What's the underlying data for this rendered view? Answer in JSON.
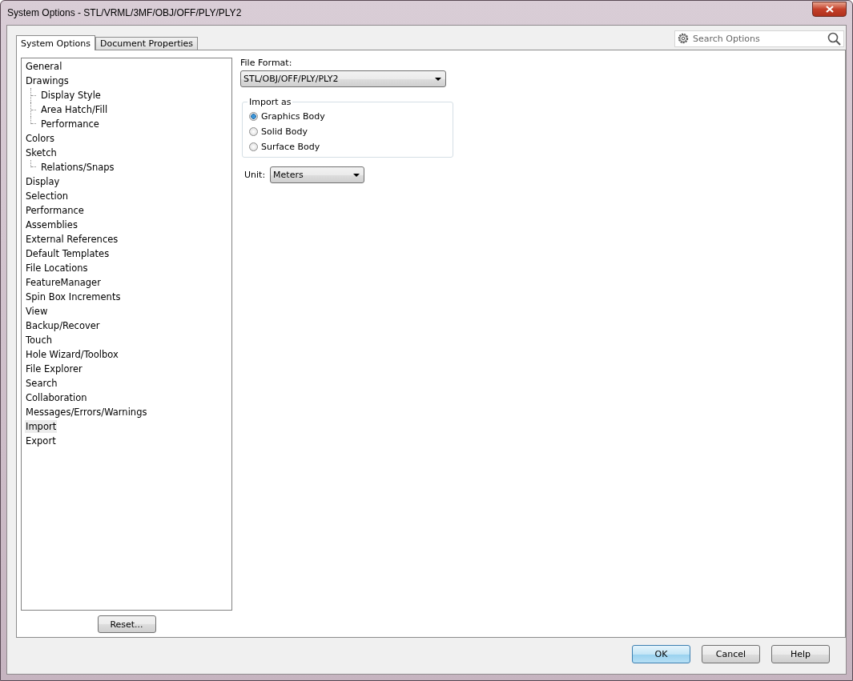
{
  "window": {
    "title": "System Options - STL/VRML/3MF/OBJ/OFF/PLY/PLY2"
  },
  "tabs": [
    {
      "label": "System Options",
      "selected": true
    },
    {
      "label": "Document Properties",
      "selected": false
    }
  ],
  "search": {
    "placeholder": "Search Options"
  },
  "tree": [
    {
      "label": "General",
      "selected": false
    },
    {
      "label": "Drawings",
      "selected": false,
      "children": [
        {
          "label": "Display Style",
          "selected": false
        },
        {
          "label": "Area Hatch/Fill",
          "selected": false
        },
        {
          "label": "Performance",
          "selected": false
        }
      ]
    },
    {
      "label": "Colors",
      "selected": false
    },
    {
      "label": "Sketch",
      "selected": false,
      "children": [
        {
          "label": "Relations/Snaps",
          "selected": false
        }
      ]
    },
    {
      "label": "Display",
      "selected": false
    },
    {
      "label": "Selection",
      "selected": false
    },
    {
      "label": "Performance",
      "selected": false
    },
    {
      "label": "Assemblies",
      "selected": false
    },
    {
      "label": "External References",
      "selected": false
    },
    {
      "label": "Default Templates",
      "selected": false
    },
    {
      "label": "File Locations",
      "selected": false
    },
    {
      "label": "FeatureManager",
      "selected": false
    },
    {
      "label": "Spin Box Increments",
      "selected": false
    },
    {
      "label": "View",
      "selected": false
    },
    {
      "label": "Backup/Recover",
      "selected": false
    },
    {
      "label": "Touch",
      "selected": false
    },
    {
      "label": "Hole Wizard/Toolbox",
      "selected": false
    },
    {
      "label": "File Explorer",
      "selected": false
    },
    {
      "label": "Search",
      "selected": false
    },
    {
      "label": "Collaboration",
      "selected": false
    },
    {
      "label": "Messages/Errors/Warnings",
      "selected": false
    },
    {
      "label": "Import",
      "selected": true
    },
    {
      "label": "Export",
      "selected": false
    }
  ],
  "reset_button": "Reset...",
  "file_format": {
    "label": "File Format:",
    "value": "STL/OBJ/OFF/PLY/PLY2"
  },
  "import_as": {
    "title": "Import as",
    "options": [
      {
        "label": "Graphics Body",
        "selected": true
      },
      {
        "label": "Solid Body",
        "selected": false
      },
      {
        "label": "Surface Body",
        "selected": false
      }
    ]
  },
  "unit": {
    "label": "Unit:",
    "value": "Meters"
  },
  "buttons": [
    {
      "label": "OK",
      "default": true
    },
    {
      "label": "Cancel",
      "default": false
    },
    {
      "label": "Help",
      "default": false
    }
  ]
}
